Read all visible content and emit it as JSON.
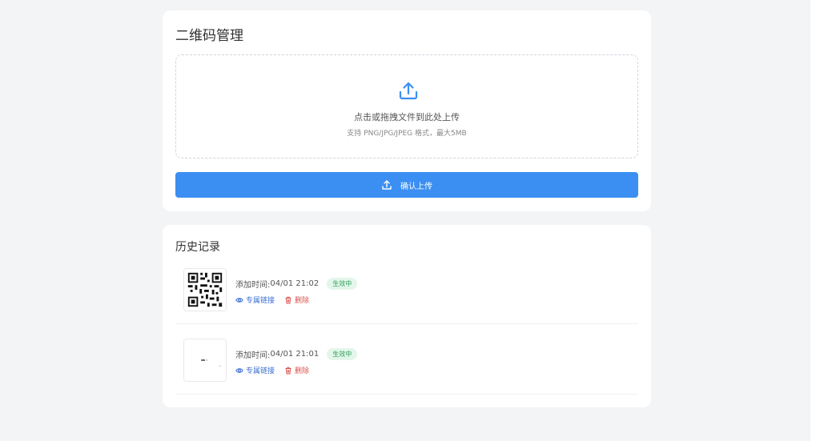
{
  "upload_card": {
    "title": "二维码管理",
    "dropzone_main": "点击或拖拽文件到此处上传",
    "dropzone_sub": "支持 PNG/JPG/JPEG 格式，最大5MB",
    "confirm_label": "确认上传"
  },
  "history": {
    "title": "历史记录",
    "records": [
      {
        "time_label": "添加时间:",
        "time": "04/01 21:02",
        "status": "生效中",
        "link_label": "专属链接",
        "delete_label": "删除"
      },
      {
        "time_label": "添加时间:",
        "time": "04/01 21:01",
        "status": "生效中",
        "link_label": "专属链接",
        "delete_label": "删除"
      }
    ]
  },
  "colors": {
    "primary": "#3b8ff2",
    "link": "#3b6fd4",
    "danger": "#d9534f",
    "status_bg": "#e3f6ea",
    "status_text": "#2f9e5a"
  },
  "icons": {
    "upload": "upload-icon",
    "eye": "eye-icon",
    "trash": "trash-icon"
  }
}
